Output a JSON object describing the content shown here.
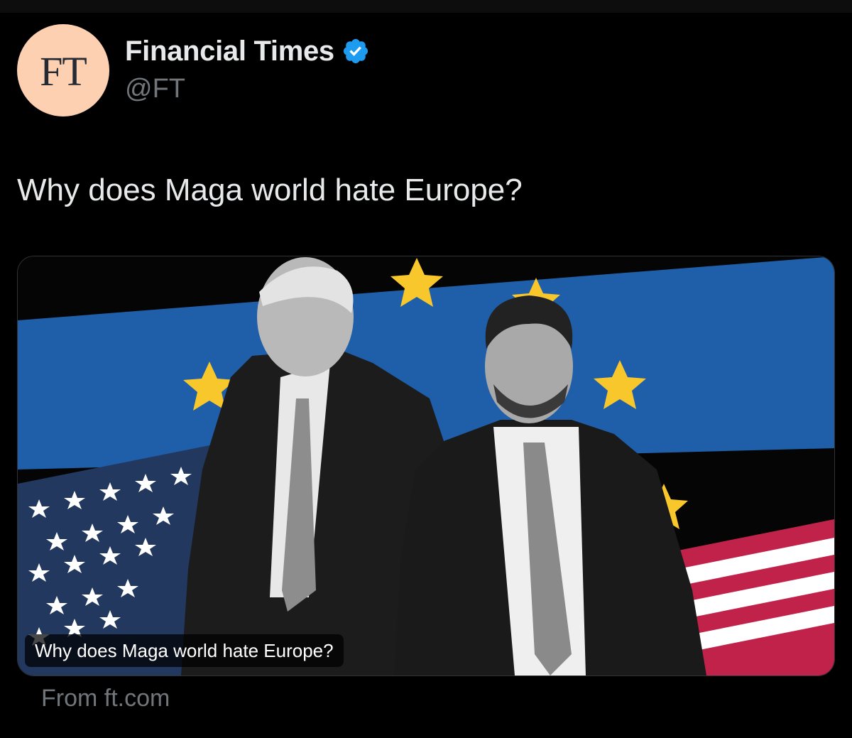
{
  "author": {
    "name": "Financial Times",
    "handle": "@FT",
    "avatar_logo": "FT",
    "verified": true,
    "verified_icon": "verified-badge-icon",
    "avatar_color": "#fcd0b1",
    "verified_color": "#1d9bf0"
  },
  "tweet": {
    "text": "Why does Maga world hate Europe?"
  },
  "link_card": {
    "caption": "Why does Maga world hate Europe?",
    "source": "From ft.com",
    "image_colors": {
      "eu_blue": "#1f5ea8",
      "eu_star": "#f7c72b",
      "us_blue": "#22385f",
      "us_red": "#c0224a"
    }
  }
}
